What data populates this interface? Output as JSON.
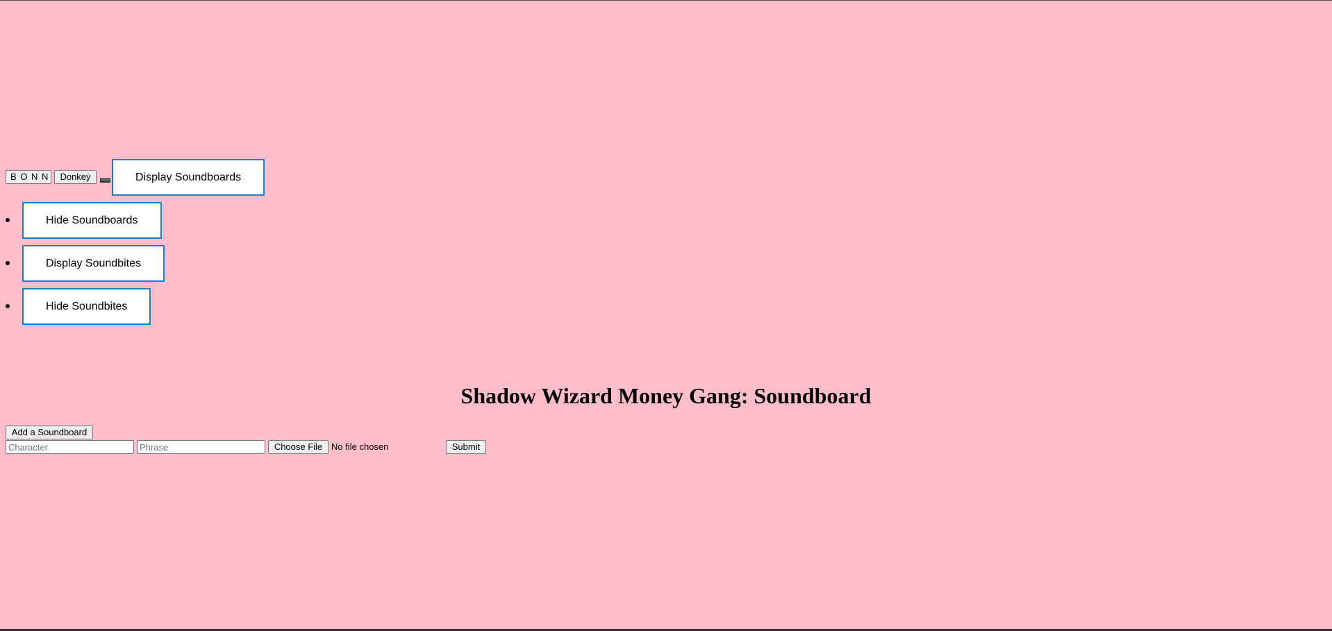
{
  "nav": {
    "bonn_label": "B O N N",
    "donkey_label": "Donkey",
    "display_soundboards_label": "Display Soundboards"
  },
  "menu": {
    "items": [
      {
        "label": "Hide Soundboards"
      },
      {
        "label": "Display Soundbites"
      },
      {
        "label": "Hide Soundbites"
      }
    ]
  },
  "page": {
    "title": "Shadow Wizard Money Gang: Soundboard"
  },
  "form": {
    "add_button_label": "Add a Soundboard",
    "character_placeholder": "Character",
    "character_value": "",
    "phrase_placeholder": "Phrase",
    "phrase_value": "",
    "choose_file_label": "Choose File",
    "file_status": "No file chosen",
    "submit_label": "Submit"
  },
  "colors": {
    "background": "#ffbdca",
    "accent_border": "#1a7fc9"
  },
  "icons": {
    "media": "image-icon"
  }
}
